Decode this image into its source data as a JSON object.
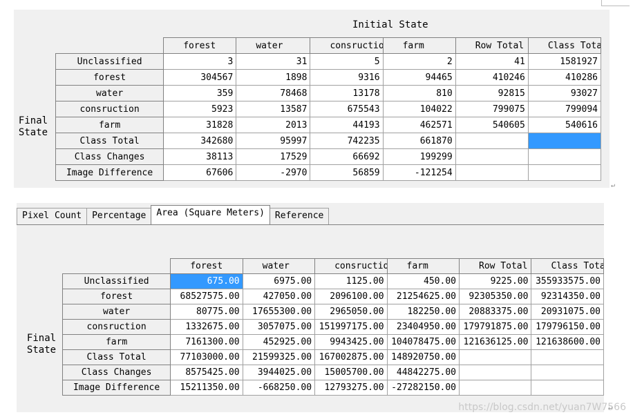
{
  "top": {
    "title": "Initial State",
    "final_state_label": "Final\nState",
    "columns": [
      "forest",
      "water",
      "consruction",
      "farm",
      "Row Total",
      "Class Total"
    ],
    "rows": [
      {
        "label": "Unclassified",
        "values": [
          "3",
          "31",
          "5",
          "2",
          "41",
          "1581927"
        ]
      },
      {
        "label": "forest",
        "values": [
          "304567",
          "1898",
          "9316",
          "94465",
          "410246",
          "410286"
        ]
      },
      {
        "label": "water",
        "values": [
          "359",
          "78468",
          "13178",
          "810",
          "92815",
          "93027"
        ]
      },
      {
        "label": "consruction",
        "values": [
          "5923",
          "13587",
          "675543",
          "104022",
          "799075",
          "799094"
        ]
      },
      {
        "label": "farm",
        "values": [
          "31828",
          "2013",
          "44193",
          "462571",
          "540605",
          "540616"
        ]
      },
      {
        "label": "Class Total",
        "values": [
          "342680",
          "95997",
          "742235",
          "661870",
          "",
          ""
        ]
      },
      {
        "label": "Class Changes",
        "values": [
          "38113",
          "17529",
          "66692",
          "199299",
          "",
          ""
        ]
      },
      {
        "label": "Image Difference",
        "values": [
          "67606",
          "-2970",
          "56859",
          "-121254",
          "",
          ""
        ]
      }
    ]
  },
  "tabs": [
    "Pixel Count",
    "Percentage",
    "Area (Square Meters)",
    "Reference"
  ],
  "active_tab": "Area (Square Meters)",
  "bottom": {
    "final_state_label": "Final\nState",
    "columns": [
      "forest",
      "water",
      "consruction",
      "farm",
      "Row Total",
      "Class Total"
    ],
    "rows": [
      {
        "label": "Unclassified",
        "values": [
          "675.00",
          "6975.00",
          "1125.00",
          "450.00",
          "9225.00",
          "355933575.00"
        ]
      },
      {
        "label": "forest",
        "values": [
          "68527575.00",
          "427050.00",
          "2096100.00",
          "21254625.00",
          "92305350.00",
          "92314350.00"
        ]
      },
      {
        "label": "water",
        "values": [
          "80775.00",
          "17655300.00",
          "2965050.00",
          "182250.00",
          "20883375.00",
          "20931075.00"
        ]
      },
      {
        "label": "consruction",
        "values": [
          "1332675.00",
          "3057075.00",
          "151997175.00",
          "23404950.00",
          "179791875.00",
          "179796150.00"
        ]
      },
      {
        "label": "farm",
        "values": [
          "7161300.00",
          "452925.00",
          "9943425.00",
          "104078475.00",
          "121636125.00",
          "121638600.00"
        ]
      },
      {
        "label": "Class Total",
        "values": [
          "77103000.00",
          "21599325.00",
          "167002875.00",
          "148920750.00",
          "",
          ""
        ]
      },
      {
        "label": "Class Changes",
        "values": [
          "8575425.00",
          "3944025.00",
          "15005700.00",
          "44842275.00",
          "",
          ""
        ]
      },
      {
        "label": "Image Difference",
        "values": [
          "15211350.00",
          "-668250.00",
          "12793275.00",
          "-27282150.00",
          "",
          ""
        ]
      }
    ]
  },
  "watermark": "https://blog.csdn.net/yuan7W7566"
}
